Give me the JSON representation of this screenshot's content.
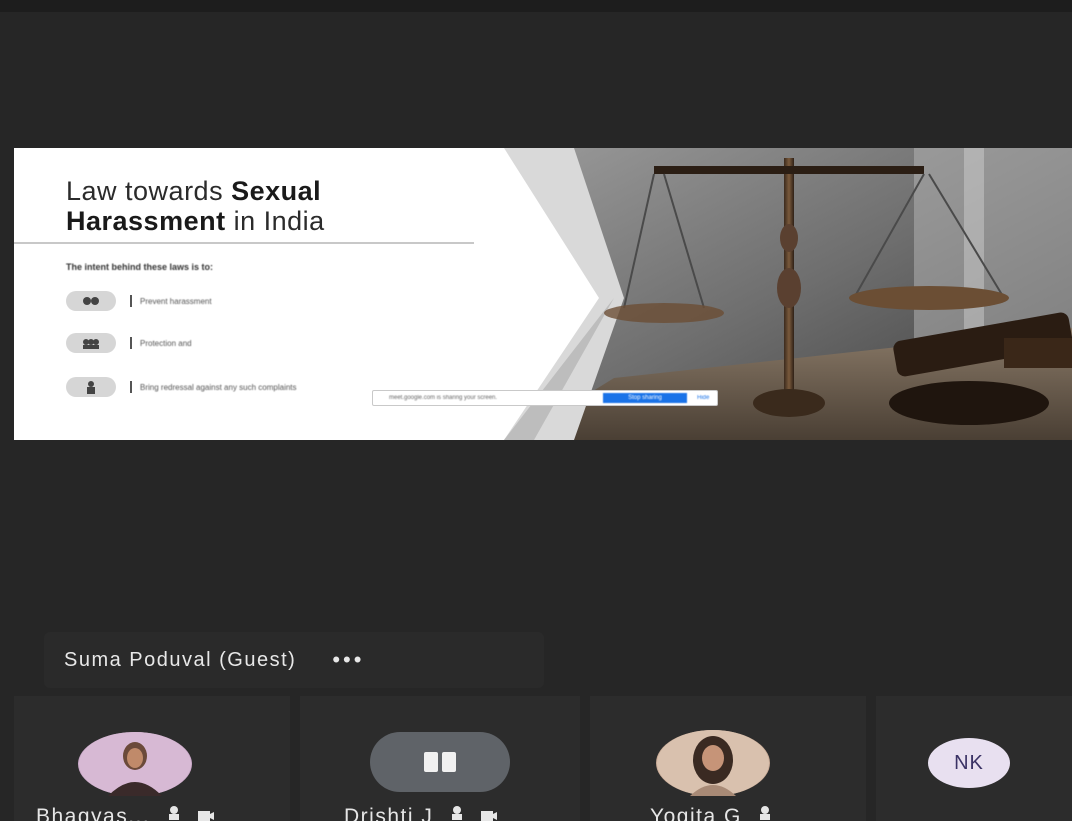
{
  "slide": {
    "title_part1": "Law towards ",
    "title_bold1": "Sexual",
    "title_bold2": "Harassment",
    "title_part2": " in India",
    "subheading": "The intent behind these laws is to:",
    "bullets": [
      {
        "text": "Prevent harassment",
        "icon": "handshake-icon"
      },
      {
        "text": "Protection and",
        "icon": "group-icon"
      },
      {
        "text": "Bring redressal against any such complaints",
        "icon": "person-icon"
      }
    ]
  },
  "share_bar": {
    "message": "meet.google.com is sharing your screen.",
    "stop_label": "Stop sharing",
    "hide_label": "Hide"
  },
  "presenter": {
    "name": "Suma Poduval (Guest)",
    "more_label": "•••"
  },
  "participants": [
    {
      "name": "Bhagyas...",
      "avatar_type": "photo",
      "avatar_color": "#c9a8c8",
      "icons": [
        "pin-icon",
        "camera-icon"
      ]
    },
    {
      "name": "Drishti J",
      "avatar_type": "pause",
      "avatar_color": "#5f6368",
      "icons": [
        "pin-icon",
        "camera-icon"
      ]
    },
    {
      "name": "Yogita G",
      "avatar_type": "photo",
      "avatar_color": "#c8aa96",
      "icons": [
        "pin-icon"
      ]
    },
    {
      "name": "",
      "initials": "NK",
      "avatar_type": "initials",
      "avatar_color": "#e8e0f0"
    }
  ],
  "colors": {
    "background": "#262626",
    "tile": "#2c2c2c",
    "accent_blue": "#1a73e8"
  }
}
